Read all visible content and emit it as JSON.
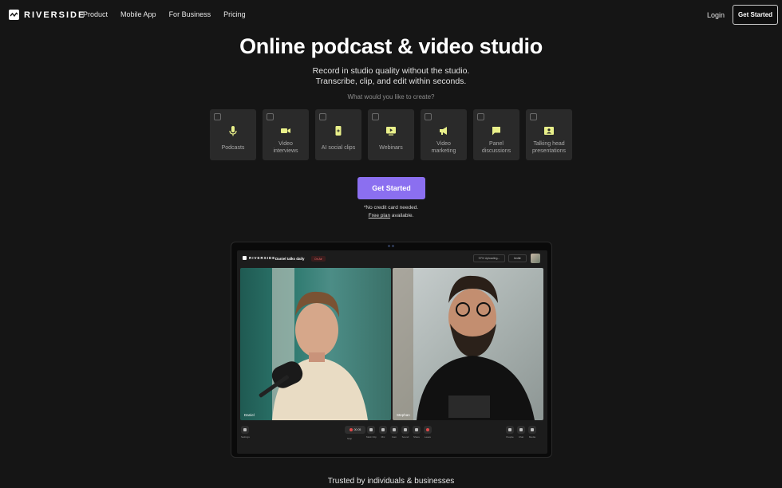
{
  "nav": {
    "logo": "RIVERSIDE",
    "links": [
      "Product",
      "Mobile App",
      "For Business",
      "Pricing"
    ],
    "login": "Login",
    "cta": "Get Started"
  },
  "hero": {
    "title": "Online podcast & video studio",
    "subtitle_line1": "Record in studio quality without the studio.",
    "subtitle_line2": "Transcribe, clip, and edit within seconds.",
    "question": "What would you like to create?",
    "options": [
      {
        "line1": "Podcasts",
        "line2": "",
        "icon": "microphone-icon"
      },
      {
        "line1": "Video",
        "line2": "interviews",
        "icon": "video-camera-icon"
      },
      {
        "line1": "AI social clips",
        "line2": "",
        "icon": "phone-sparkle-icon"
      },
      {
        "line1": "Webinars",
        "line2": "",
        "icon": "screen-play-icon"
      },
      {
        "line1": "Video",
        "line2": "marketing",
        "icon": "megaphone-icon"
      },
      {
        "line1": "Panel",
        "line2": "discussions",
        "icon": "chat-bubble-icon"
      },
      {
        "line1": "Talking head",
        "line2": "presentations",
        "icon": "presenter-icon"
      }
    ],
    "cta": "Get Started",
    "note_line1": "*No credit card needed.",
    "note_free": "Free plan",
    "note_rest": " available."
  },
  "studio": {
    "logo": "RIVERSIDE",
    "session_title": "Daniel talks daily",
    "live_badge": "On Air",
    "uploading": "97% Uploading...",
    "invite": "Invite",
    "participants": [
      "Daniel",
      "Stephan"
    ],
    "timer": "00:05",
    "controls_left": [
      "Settings"
    ],
    "controls_center": [
      "Stop",
      "Mark Clip",
      "Mic",
      "Cam",
      "Sound",
      "Share",
      "Leave"
    ],
    "controls_right": [
      "People",
      "Chat",
      "Media"
    ]
  },
  "footer": {
    "trusted": "Trusted by individuals & businesses"
  },
  "colors": {
    "background": "#151515",
    "accent": "#8b6ff0",
    "card": "#2a2a2a",
    "icon_yellow": "#e9f08a"
  }
}
